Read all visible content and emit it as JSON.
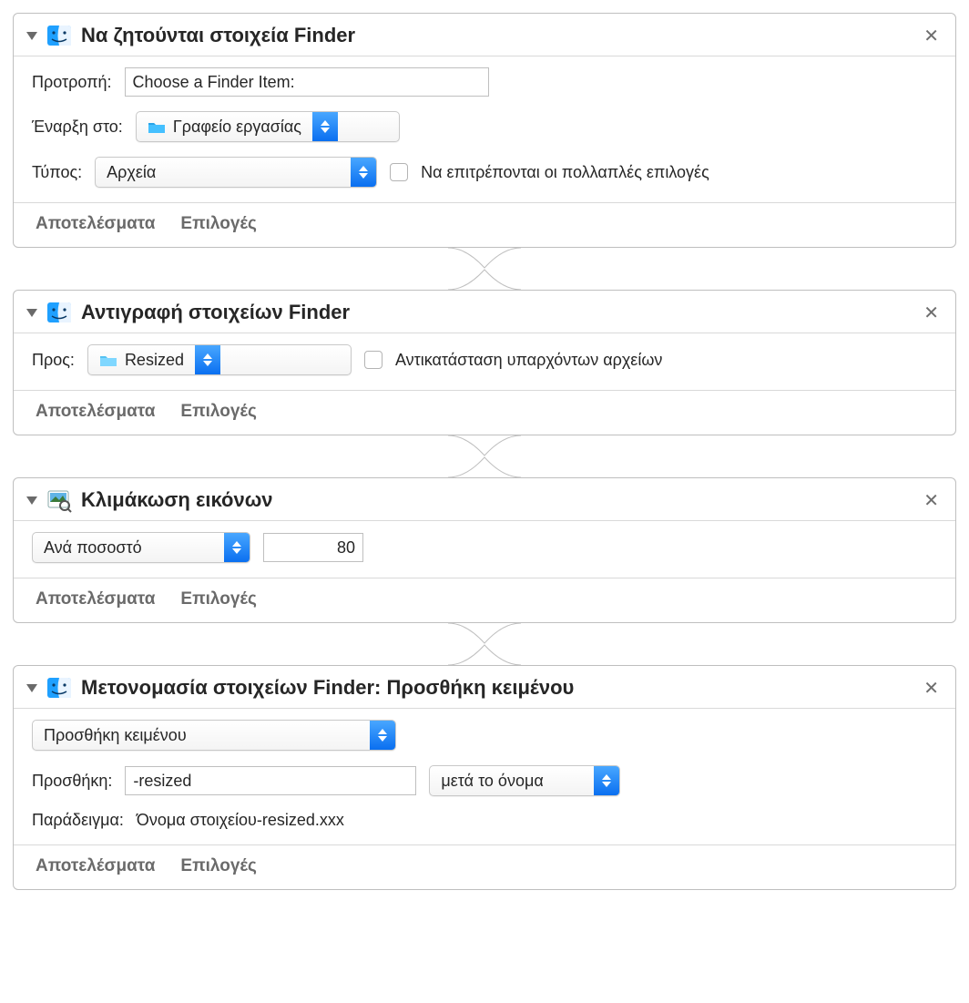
{
  "footer": {
    "results": "Αποτελέσματα",
    "options": "Επιλογές"
  },
  "actions": [
    {
      "title": "Να ζητούνται στοιχεία Finder",
      "promptLabel": "Προτροπή:",
      "promptValue": "Choose a Finder Item:",
      "startLabel": "Έναρξη στο:",
      "startValue": "Γραφείο εργασίας",
      "typeLabel": "Τύπος:",
      "typeValue": "Αρχεία",
      "multiLabel": "Να επιτρέπονται οι πολλαπλές επιλογές"
    },
    {
      "title": "Αντιγραφή στοιχείων Finder",
      "toLabel": "Προς:",
      "toValue": "Resized",
      "replaceLabel": "Αντικατάσταση υπαρχόντων αρχείων"
    },
    {
      "title": "Κλιμάκωση εικόνων",
      "modeValue": "Ανά ποσοστό",
      "numValue": "80"
    },
    {
      "title": "Μετονομασία στοιχείων Finder: Προσθήκη κειμένου",
      "modeValue": "Προσθήκη κειμένου",
      "addLabel": "Προσθήκη:",
      "addValue": "-resized",
      "afterValue": "μετά το όνομα",
      "exampleLabel": "Παράδειγμα:",
      "exampleValue": "Όνομα στοιχείου-resized.xxx"
    }
  ]
}
